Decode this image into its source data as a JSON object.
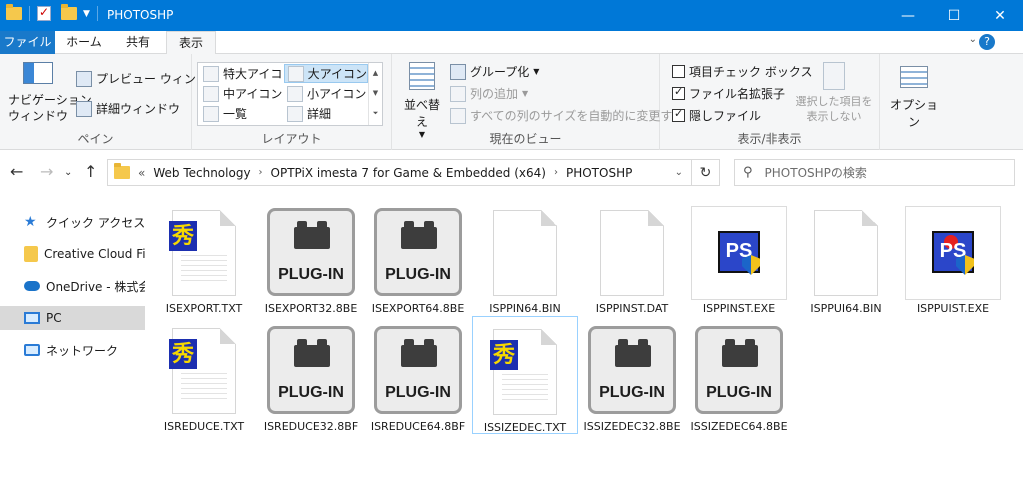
{
  "window": {
    "title": "PHOTOSHP",
    "minimize_icon": "minimize-icon",
    "maximize_icon": "maximize-icon",
    "close_icon": "close-icon"
  },
  "tabs": [
    "ファイル",
    "ホーム",
    "共有",
    "表示"
  ],
  "active_tab": "表示",
  "ribbon": {
    "pane_group": {
      "nav_pane": "ナビゲーション\nウィンドウ",
      "preview_pane": "プレビュー ウィンドウ",
      "details_pane": "詳細ウィンドウ",
      "label": "ペイン"
    },
    "layout_group": {
      "items": [
        "特大アイコン",
        "大アイコン",
        "中アイコン",
        "小アイコン",
        "一覧",
        "詳細"
      ],
      "selected": "大アイコン",
      "label": "レイアウト"
    },
    "view_group": {
      "sort": "並べ替え",
      "group_by": "グループ化",
      "add_column": "列の追加",
      "fit_columns": "すべての列のサイズを自動的に変更する",
      "label": "現在のビュー"
    },
    "show_hide_group": {
      "item_checkbox": "項目チェック ボックス",
      "item_checkbox_checked": false,
      "extensions": "ファイル名拡張子",
      "extensions_checked": true,
      "hidden": "隠しファイル",
      "hidden_checked": true,
      "hide_selected": "選択した項目を\n表示しない",
      "label": "表示/非表示"
    },
    "options": "オプション"
  },
  "address": {
    "prefix": "«",
    "crumbs": [
      "Web Technology",
      "OPTPiX imesta 7 for Game & Embedded (x64)",
      "PHOTOSHP"
    ]
  },
  "search": {
    "placeholder": "PHOTOSHPの検索"
  },
  "nav": {
    "items": [
      {
        "label": "クイック アクセス",
        "icon": "star-icon"
      },
      {
        "label": "Creative Cloud Files",
        "icon": "creative-cloud-icon"
      },
      {
        "label": "OneDrive - 株式会社",
        "icon": "onedrive-icon"
      },
      {
        "label": "PC",
        "icon": "pc-icon"
      },
      {
        "label": "ネットワーク",
        "icon": "network-icon"
      }
    ],
    "selected": "PC"
  },
  "files": [
    {
      "name": "ISEXPORT.TXT",
      "type": "txt-kanji"
    },
    {
      "name": "ISEXPORT32.8BE",
      "type": "plugin"
    },
    {
      "name": "ISEXPORT64.8BE",
      "type": "plugin"
    },
    {
      "name": "ISPPIN64.BIN",
      "type": "blank"
    },
    {
      "name": "ISPPINST.DAT",
      "type": "blank"
    },
    {
      "name": "ISPPINST.EXE",
      "type": "exe"
    },
    {
      "name": "ISPPUI64.BIN",
      "type": "blank"
    },
    {
      "name": "ISPPUIST.EXE",
      "type": "exe-red"
    },
    {
      "name": "ISREDUCE.TXT",
      "type": "txt-kanji"
    },
    {
      "name": "ISREDUCE32.8BF",
      "type": "plugin"
    },
    {
      "name": "ISREDUCE64.8BF",
      "type": "plugin"
    },
    {
      "name": "ISSIZEDEC.TXT",
      "type": "txt-kanji"
    },
    {
      "name": "ISSIZEDEC32.8BE",
      "type": "plugin"
    },
    {
      "name": "ISSIZEDEC64.8BE",
      "type": "plugin"
    }
  ],
  "plugin_label": "PLUG-IN",
  "kanji_glyph": "秀",
  "ps_glyph": "PS"
}
